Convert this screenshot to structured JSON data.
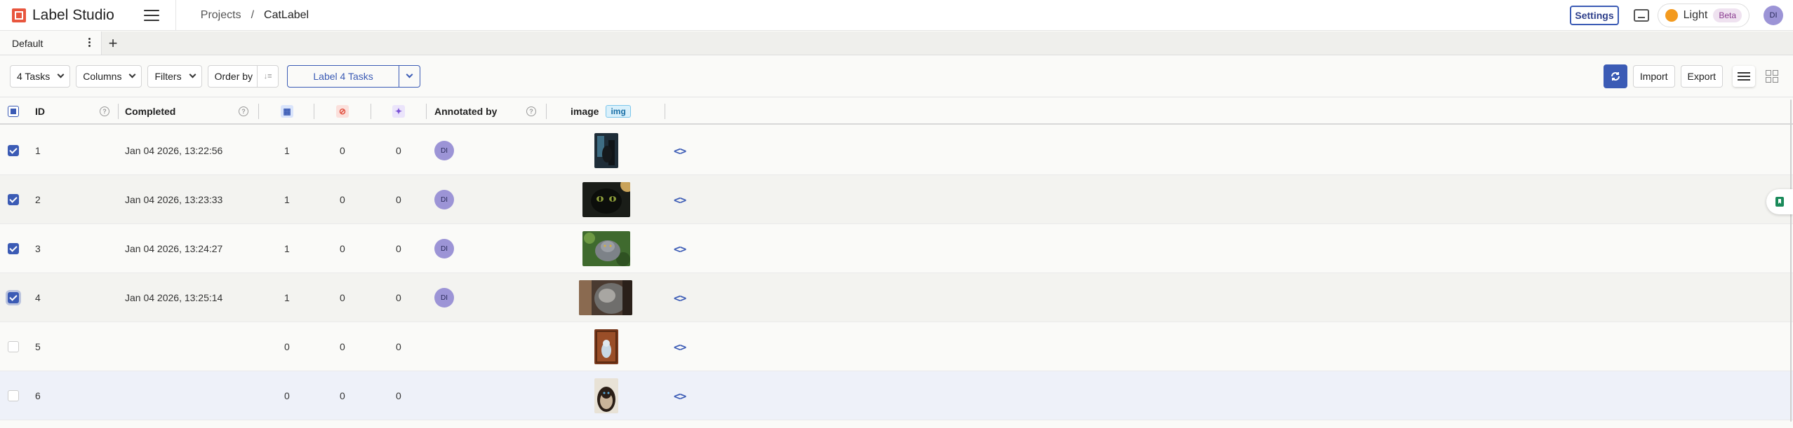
{
  "app": {
    "title": "Label Studio"
  },
  "breadcrumb": {
    "projects": "Projects",
    "separator": "/",
    "project": "CatLabel"
  },
  "topbar": {
    "settings_label": "Settings",
    "theme_label": "Light",
    "beta_label": "Beta",
    "user_initials": "DI"
  },
  "tabs": [
    {
      "label": "Default"
    }
  ],
  "toolbar": {
    "tasks_label": "4 Tasks",
    "columns_label": "Columns",
    "filters_label": "Filters",
    "order_by_label": "Order by",
    "label_tasks_label": "Label 4 Tasks",
    "import_label": "Import",
    "export_label": "Export"
  },
  "table": {
    "headers": {
      "id": "ID",
      "completed": "Completed",
      "annotated_by": "Annotated by",
      "image": "image",
      "image_badge": "img"
    },
    "rows": [
      {
        "id": "1",
        "completed": "Jan 04 2026, 13:22:56",
        "annotations": "1",
        "cancelled": "0",
        "predictions": "0",
        "annotator": "DI",
        "checked": true,
        "thumb": "dark-cat-tall"
      },
      {
        "id": "2",
        "completed": "Jan 04 2026, 13:23:33",
        "annotations": "1",
        "cancelled": "0",
        "predictions": "0",
        "annotator": "DI",
        "checked": true,
        "thumb": "black-cat-face"
      },
      {
        "id": "3",
        "completed": "Jan 04 2026, 13:24:27",
        "annotations": "1",
        "cancelled": "0",
        "predictions": "0",
        "annotator": "DI",
        "checked": true,
        "thumb": "grey-cat-garden"
      },
      {
        "id": "4",
        "completed": "Jan 04 2026, 13:25:14",
        "annotations": "1",
        "cancelled": "0",
        "predictions": "0",
        "annotator": "DI",
        "checked": true,
        "thumb": "grey-cat-closeup"
      },
      {
        "id": "5",
        "completed": "",
        "annotations": "0",
        "cancelled": "0",
        "predictions": "0",
        "annotator": "",
        "checked": false,
        "thumb": "white-cat-door"
      },
      {
        "id": "6",
        "completed": "",
        "annotations": "0",
        "cancelled": "0",
        "predictions": "0",
        "annotator": "",
        "checked": false,
        "thumb": "siamese-cat"
      }
    ]
  },
  "colors": {
    "accent": "#3b5bb5",
    "avatar": "#9c94d6",
    "theme_dot": "#f39a1e",
    "row_highlight": "#eef1f9"
  }
}
